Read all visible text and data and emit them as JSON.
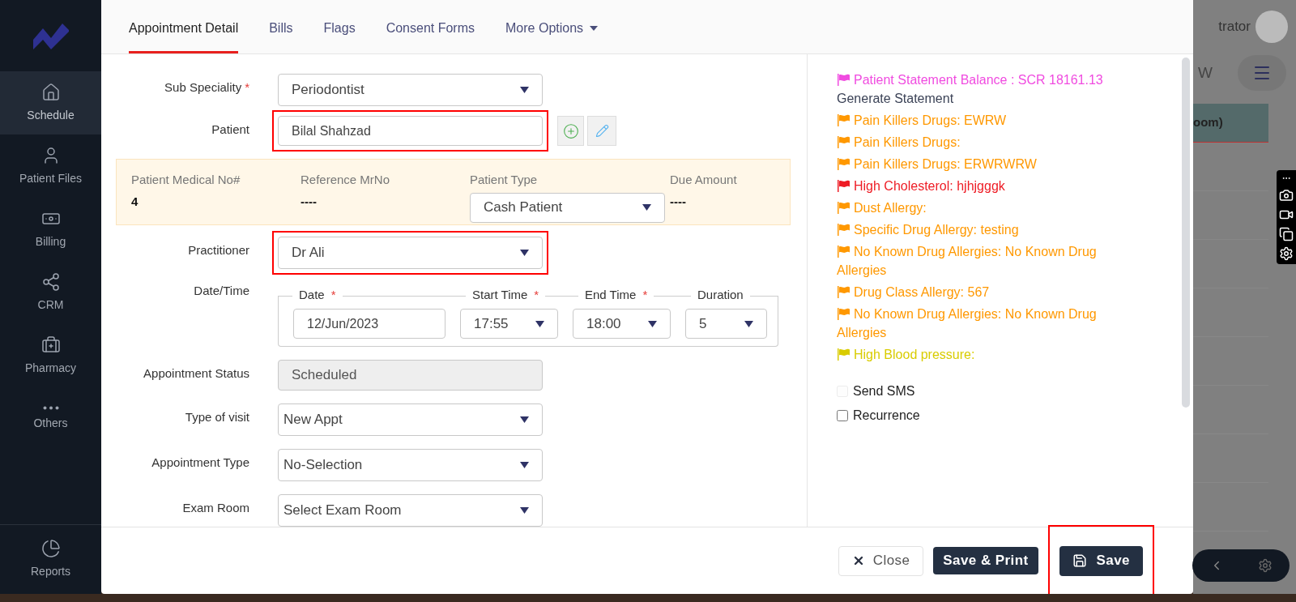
{
  "sidebar": {
    "items": [
      {
        "label": "Schedule",
        "selected": true
      },
      {
        "label": "Patient Files",
        "selected": false
      },
      {
        "label": "Billing",
        "selected": false
      },
      {
        "label": "CRM",
        "selected": false
      },
      {
        "label": "Pharmacy",
        "selected": false
      },
      {
        "label": "Others",
        "selected": false
      }
    ],
    "bottom_item": {
      "label": "Reports",
      "selected": false
    }
  },
  "tabs": [
    {
      "label": "Appointment Detail",
      "selected": true,
      "kind": "tab"
    },
    {
      "label": "Bills",
      "selected": false,
      "kind": "tab"
    },
    {
      "label": "Flags",
      "selected": false,
      "kind": "tab"
    },
    {
      "label": "Consent Forms",
      "selected": false,
      "kind": "tab"
    },
    {
      "label": "More Options",
      "selected": false,
      "kind": "dropdown"
    }
  ],
  "form": {
    "sub_speciality": {
      "label": "Sub Speciality",
      "required_mark": "*",
      "value": "Periodontist",
      "highlighted": false
    },
    "patient": {
      "label": "Patient",
      "value": "Bilal Shahzad",
      "highlighted": true
    },
    "banner": [
      {
        "label": "Patient Medical No#",
        "value": "4",
        "kind": "text"
      },
      {
        "label": "Reference MrNo",
        "value": "----",
        "kind": "text"
      },
      {
        "label": "Patient Type",
        "value": "Cash Patient",
        "kind": "select"
      },
      {
        "label": "Due Amount",
        "value": "----",
        "kind": "text"
      }
    ],
    "practitioner": {
      "label": "Practitioner",
      "value": "Dr Ali",
      "highlighted": true
    },
    "date_time": {
      "label": "Date/Time",
      "fields": [
        {
          "label": "Date",
          "required_mark": "*",
          "value": "12/Jun/2023",
          "kind": "text"
        },
        {
          "label": "Start Time",
          "required_mark": "*",
          "value": "17:55",
          "kind": "select"
        },
        {
          "label": "End Time",
          "required_mark": "*",
          "value": "18:00",
          "kind": "select"
        },
        {
          "label": "Duration",
          "value": "5",
          "kind": "select"
        }
      ]
    },
    "rows": [
      {
        "label": "Appointment Status",
        "value": "Scheduled",
        "kind": "disabled"
      },
      {
        "label": "Type of visit",
        "value": "New Appt",
        "kind": "select"
      },
      {
        "label": "Appointment Type",
        "value": "No-Selection",
        "kind": "select"
      },
      {
        "label": "Exam Room",
        "value": "Select Exam Room",
        "kind": "select"
      }
    ]
  },
  "flags": [
    {
      "text": "Patient Statement Balance : SCR 18161.13",
      "link": "Generate Statement",
      "color": "#f04be0",
      "kind": "statement"
    },
    {
      "text": "Pain Killers Drugs: EWRW",
      "color": "#ff9800",
      "kind": "flag"
    },
    {
      "text": "Pain Killers Drugs:",
      "color": "#ff9800",
      "kind": "flag"
    },
    {
      "text": "Pain Killers Drugs: ERWRWRW",
      "color": "#ff9800",
      "kind": "flag"
    },
    {
      "text": "High Cholesterol: hjhjgggk",
      "color": "#ee1c25",
      "kind": "flag"
    },
    {
      "text": "Dust Allergy:",
      "color": "#ff9800",
      "kind": "flag"
    },
    {
      "text": "Specific Drug Allergy: testing",
      "color": "#ff9800",
      "kind": "flag"
    },
    {
      "text": "No Known Drug Allergies: No Known Drug Allergies",
      "color": "#ff9800",
      "kind": "flag"
    },
    {
      "text": "Drug Class Allergy: 567",
      "color": "#ff9800",
      "kind": "flag"
    },
    {
      "text": "No Known Drug Allergies: No Known Drug Allergies",
      "color": "#ff9800",
      "kind": "flag"
    },
    {
      "text": "High Blood pressure:",
      "color": "#d9cc00",
      "kind": "flag"
    }
  ],
  "options": [
    {
      "label": "Send SMS",
      "checked": false,
      "disabled": true
    },
    {
      "label": "Recurrence",
      "checked": false,
      "disabled": false
    }
  ],
  "footer": {
    "buttons": [
      {
        "label": "Close",
        "kind": "close",
        "highlighted": false
      },
      {
        "label": "Save & Print",
        "kind": "primary",
        "highlighted": false
      },
      {
        "label": "Save",
        "kind": "save",
        "highlighted": true
      }
    ]
  },
  "background": {
    "user_name": "trator",
    "button_text": "W",
    "column_header": "oom)"
  }
}
